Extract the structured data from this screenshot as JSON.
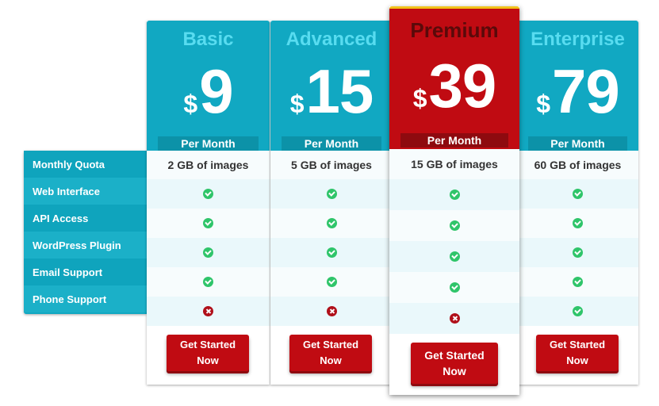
{
  "features": [
    "Monthly Quota",
    "Web Interface",
    "API Access",
    "WordPress Plugin",
    "Email Support",
    "Phone Support"
  ],
  "plans": [
    {
      "name": "Basic",
      "currency": "$",
      "price": "9",
      "period": "Per Month",
      "quota": "2 GB of images",
      "features": [
        "check",
        "check",
        "check",
        "check",
        "cross"
      ],
      "button_line1": "Get Started",
      "button_line2": "Now"
    },
    {
      "name": "Advanced",
      "currency": "$",
      "price": "15",
      "period": "Per Month",
      "quota": "5 GB of images",
      "features": [
        "check",
        "check",
        "check",
        "check",
        "cross"
      ],
      "button_line1": "Get Started",
      "button_line2": "Now"
    },
    {
      "name": "Premium",
      "currency": "$",
      "price": "39",
      "period": "Per Month",
      "quota": "15 GB of images",
      "features": [
        "check",
        "check",
        "check",
        "check",
        "cross"
      ],
      "button_line1": "Get Started",
      "button_line2": "Now"
    },
    {
      "name": "Enterprise",
      "currency": "$",
      "price": "79",
      "period": "Per Month",
      "quota": "60 GB of images",
      "features": [
        "check",
        "check",
        "check",
        "check",
        "check"
      ],
      "button_line1": "Get Started",
      "button_line2": "Now"
    }
  ],
  "colors": {
    "accent": "#11a8c2",
    "highlight": "#c00b12",
    "check": "#2fc56a",
    "cross": "#b0101a",
    "premium_border": "#f2c21a"
  }
}
